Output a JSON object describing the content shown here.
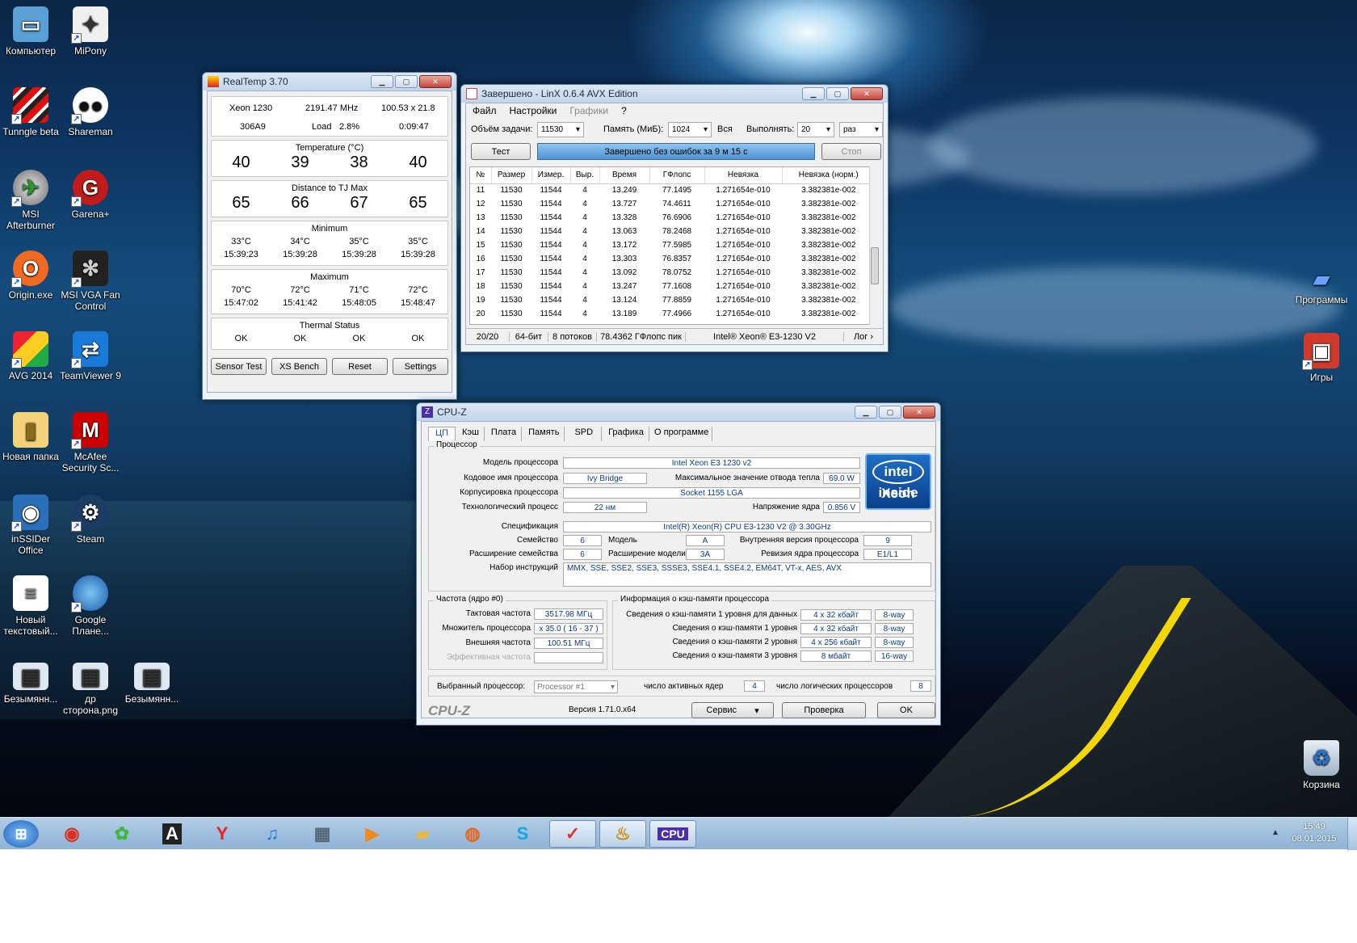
{
  "desktop_icons": [
    {
      "label": "Компьютер",
      "icon": "computer-icon"
    },
    {
      "label": "MiPony",
      "icon": "mipony-icon"
    },
    {
      "label": "Tunngle beta",
      "icon": "tunngle-icon"
    },
    {
      "label": "Shareman",
      "icon": "shareman-icon"
    },
    {
      "label": "MSI Afterburner",
      "icon": "afterburner-icon"
    },
    {
      "label": "Garena+",
      "icon": "garena-icon"
    },
    {
      "label": "Origin.exe",
      "icon": "origin-icon"
    },
    {
      "label": "MSI VGA Fan Control",
      "icon": "fan-icon"
    },
    {
      "label": "AVG 2014",
      "icon": "avg-icon"
    },
    {
      "label": "TeamViewer 9",
      "icon": "teamviewer-icon"
    },
    {
      "label": "Новая папка",
      "icon": "folder-icon"
    },
    {
      "label": "McAfee Security Sc...",
      "icon": "mcafee-icon"
    },
    {
      "label": "inSSIDer Office",
      "icon": "inssider-icon"
    },
    {
      "label": "Steam",
      "icon": "steam-icon"
    },
    {
      "label": "Новый текстовый...",
      "icon": "text-file-icon"
    },
    {
      "label": "Google Плане...",
      "icon": "google-earth-icon"
    },
    {
      "label": "Безымянн...",
      "icon": "image-file-icon"
    },
    {
      "label": "др сторона.png",
      "icon": "image-file-icon"
    },
    {
      "label": "Безымянн...",
      "icon": "image-file-icon"
    },
    {
      "label": "Программы",
      "icon": "programs-icon"
    },
    {
      "label": "Игры",
      "icon": "games-icon"
    },
    {
      "label": "Корзина",
      "icon": "recycle-bin-icon"
    }
  ],
  "realtemp": {
    "title": "RealTemp 3.70",
    "cpu": "Xeon 1230",
    "freq": "2191.47 MHz",
    "mult": "100.53 x 21.8",
    "stepping": "306A9",
    "load_label": "Load",
    "load": "2.8%",
    "uptime": "0:09:47",
    "temp_title": "Temperature (°C)",
    "temps": [
      "40",
      "39",
      "38",
      "40"
    ],
    "tj_title": "Distance to TJ Max",
    "tj": [
      "65",
      "66",
      "67",
      "65"
    ],
    "min_title": "Minimum",
    "min_vals": [
      "33°C",
      "34°C",
      "35°C",
      "35°C"
    ],
    "min_times": [
      "15:39:23",
      "15:39:28",
      "15:39:28",
      "15:39:28"
    ],
    "max_title": "Maximum",
    "max_vals": [
      "70°C",
      "72°C",
      "71°C",
      "72°C"
    ],
    "max_times": [
      "15:47:02",
      "15:41:42",
      "15:48:05",
      "15:48:47"
    ],
    "thermal_title": "Thermal Status",
    "thermal": [
      "OK",
      "OK",
      "OK",
      "OK"
    ],
    "buttons": [
      "Sensor Test",
      "XS Bench",
      "Reset",
      "Settings"
    ]
  },
  "linx": {
    "title": "Завершено - LinX 0.6.4 AVX Edition",
    "menu": [
      "Файл",
      "Настройки",
      "Графики",
      "?"
    ],
    "task_label": "Объём задачи:",
    "task_value": "11530",
    "mem_label": "Память (МиБ):",
    "mem_value": "1024",
    "all_label": "Вся",
    "run_label": "Выполнять:",
    "run_value": "20",
    "run_unit": "раз",
    "test_btn": "Тест",
    "status": "Завершено без ошибок за 9 м 15 с",
    "stop_btn": "Стоп",
    "columns": [
      "№",
      "Размер",
      "Измер.",
      "Выр.",
      "Время",
      "ГФлопс",
      "Невязка",
      "Невязка (норм.)"
    ],
    "rows": [
      [
        "11",
        "11530",
        "11544",
        "4",
        "13.249",
        "77.1495",
        "1.271654e-010",
        "3.382381e-002"
      ],
      [
        "12",
        "11530",
        "11544",
        "4",
        "13.727",
        "74.4611",
        "1.271654e-010",
        "3.382381e-002"
      ],
      [
        "13",
        "11530",
        "11544",
        "4",
        "13.328",
        "76.6906",
        "1.271654e-010",
        "3.382381e-002"
      ],
      [
        "14",
        "11530",
        "11544",
        "4",
        "13.063",
        "78.2468",
        "1.271654e-010",
        "3.382381e-002"
      ],
      [
        "15",
        "11530",
        "11544",
        "4",
        "13.172",
        "77.5985",
        "1.271654e-010",
        "3.382381e-002"
      ],
      [
        "16",
        "11530",
        "11544",
        "4",
        "13.303",
        "76.8357",
        "1.271654e-010",
        "3.382381e-002"
      ],
      [
        "17",
        "11530",
        "11544",
        "4",
        "13.092",
        "78.0752",
        "1.271654e-010",
        "3.382381e-002"
      ],
      [
        "18",
        "11530",
        "11544",
        "4",
        "13.247",
        "77.1608",
        "1.271654e-010",
        "3.382381e-002"
      ],
      [
        "19",
        "11530",
        "11544",
        "4",
        "13.124",
        "77.8859",
        "1.271654e-010",
        "3.382381e-002"
      ],
      [
        "20",
        "11530",
        "11544",
        "4",
        "13.189",
        "77.4966",
        "1.271654e-010",
        "3.382381e-002"
      ]
    ],
    "status_bar": [
      "20/20",
      "64-бит",
      "8 потоков",
      "78.4362 ГФлопс пик",
      "Intel® Xeon® E3-1230 V2",
      "Лог ›"
    ]
  },
  "cpuz": {
    "title": "CPU-Z",
    "tabs": [
      "ЦП",
      "Кэш",
      "Плата",
      "Память",
      "SPD",
      "Графика",
      "О программе"
    ],
    "proc_group": "Процессор",
    "model_label": "Модель процессора",
    "model": "Intel Xeon E3 1230 v2",
    "codename_label": "Кодовое имя процессора",
    "codename": "Ivy Bridge",
    "tdp_label": "Максимальное значение отвода тепла",
    "tdp": "69.0 W",
    "package_label": "Корпусировка процессора",
    "package": "Socket 1155 LGA",
    "tech_label": "Технологический процесс",
    "tech": "22 нм",
    "voltage_label": "Напряжение ядра",
    "voltage": "0.856 V",
    "spec_label": "Спецификация",
    "spec": "Intel(R) Xeon(R) CPU E3-1230 V2 @ 3.30GHz",
    "family_label": "Семейство",
    "family": "6",
    "model2_label": "Модель",
    "model2": "A",
    "stepping_label": "Внутренняя версия процессора",
    "stepping": "9",
    "extfam_label": "Расширение семейства",
    "extfam": "6",
    "extmodel_label": "Расширение модели",
    "extmodel": "3A",
    "revision_label": "Ревизия ядра процессора",
    "revision": "E1/L1",
    "instr_label": "Набор инструкций",
    "instr": "MMX, SSE, SSE2, SSE3, SSSE3, SSE4.1, SSE4.2, EM64T, VT-x, AES, AVX",
    "badge_inside": "intel inside",
    "badge_xeon": "Xeon",
    "clock_group": "Частота (ядро #0)",
    "core_speed_label": "Тактовая частота",
    "core_speed": "3517.98 МГц",
    "mult_label": "Множитель процессора",
    "mult": "x 35.0 ( 16 - 37 )",
    "bus_label": "Внешняя частота",
    "bus": "100.51 МГц",
    "eff_label": "Эффективная частота",
    "cache_group": "Информация о кэш-памяти процессора",
    "cache_rows": [
      {
        "label": "Сведения о кэш-памяти 1 уровня для данных",
        "size": "4 x 32 кбайт",
        "way": "8-way"
      },
      {
        "label": "Сведения о кэш-памяти 1 уровня",
        "size": "4 x 32 кбайт",
        "way": "8-way"
      },
      {
        "label": "Сведения о кэш-памяти 2 уровня",
        "size": "4 x 256 кбайт",
        "way": "8-way"
      },
      {
        "label": "Сведения о кэш-памяти 3 уровня",
        "size": "8 мбайт",
        "way": "16-way"
      }
    ],
    "sel_label": "Выбранный процессор:",
    "sel_value": "Processor #1",
    "cores_label": "число активных ядер",
    "cores": "4",
    "threads_label": "число логических процессоров",
    "threads": "8",
    "brand": "CPU-Z",
    "version": "Версия 1.71.0.x64",
    "service_btn": "Сервис",
    "validate_btn": "Проверка",
    "ok_btn": "OK"
  },
  "clock": {
    "time": "15:49",
    "date": "08.01.2015"
  }
}
